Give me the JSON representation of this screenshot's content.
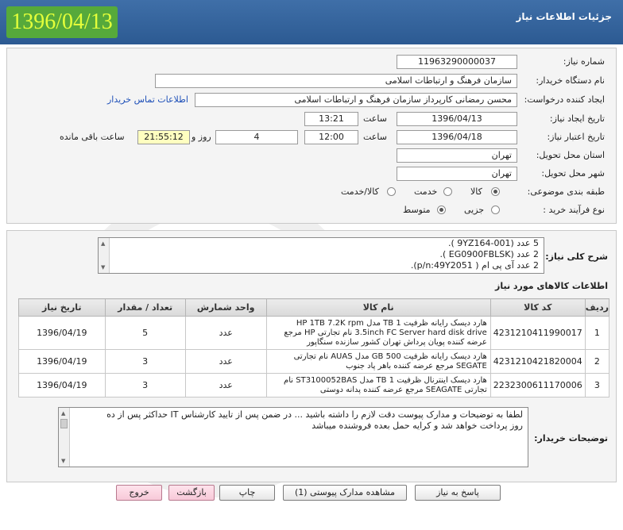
{
  "header": {
    "date": "1396/04/13",
    "title": "جزئیات اطلاعات نیاز"
  },
  "form": {
    "need_number_label": "شماره نیاز:",
    "need_number": "11963290000037",
    "buyer_org_label": "نام دستگاه خریدار:",
    "buyer_org": "سازمان فرهنگ و ارتباطات اسلامی",
    "requester_label": "ایجاد کننده درخواست:",
    "requester": "محسن رمضانی  کارپرداز سازمان فرهنگ و ارتباطات اسلامی",
    "contact_link": "اطلاعات تماس خریدار",
    "created_label": "تاریخ ایجاد نیاز:",
    "created_date": "1396/04/13",
    "time_label": "ساعت",
    "created_time": "13:21",
    "validity_label": "تاریخ اعتبار نیاز:",
    "validity_date": "1396/04/18",
    "validity_time": "12:00",
    "days": "4",
    "days_label": "روز و",
    "countdown": "21:55:12",
    "remaining_label": "ساعت باقی مانده",
    "province_label": "استان محل تحویل:",
    "province": "تهران",
    "city_label": "شهر محل تحویل:",
    "city": "تهران",
    "category_label": "طبقه بندی موضوعی:",
    "category_options": [
      "کالا",
      "خدمت",
      "کالا/خدمت"
    ],
    "category_selected": "کالا",
    "process_label": "نوع فرآیند خرید :",
    "process_options": [
      "جزیی",
      "متوسط"
    ],
    "process_selected": "متوسط"
  },
  "summary": {
    "label": "شرح کلی نیاز:",
    "lines": [
      "5 عدد  (9YZ164-001 ).",
      "2 عدد  (EG0900FBLSK ).",
      "2 عدد آی پی ام  (  p/n:49Y2051)."
    ]
  },
  "items_section_title": "اطلاعات کالاهای مورد نیاز",
  "table": {
    "headers": [
      "ردیف",
      "کد کالا",
      "نام کالا",
      "واحد شمارش",
      "تعداد / مقدار",
      "تاریخ نیاز"
    ],
    "rows": [
      {
        "idx": "1",
        "code": "4231210411990017",
        "name": "هارد دیسک رایانه ظرفیت 1 TB مدل HP 1TB 7.2K rpm 3.5inch FC Server hard disk drive نام تجارتی HP مرجع عرضه کننده پویان پرداش تهران کشور سازنده سنگاپور",
        "unit": "عدد",
        "qty": "5",
        "date": "1396/04/19"
      },
      {
        "idx": "2",
        "code": "4231210421820004",
        "name": "هارد دیسک رایانه ظرفیت 500 GB مدل AUAS نام تجارتی SEGATE مرجع عرضه کننده باهر پاد جنوب",
        "unit": "عدد",
        "qty": "3",
        "date": "1396/04/19"
      },
      {
        "idx": "3",
        "code": "2232300611170006",
        "name": "هارد دیسک اینترنال ظرفیت 1 TB مدل ST3100052BAS نام تجارتی SEAGATE مرجع عرضه کننده پدانه دوستی",
        "unit": "عدد",
        "qty": "3",
        "date": "1396/04/19"
      }
    ]
  },
  "buyer_notes": {
    "label": "توضیحات خریدار:",
    "lines": [
      "لطفا به توضیحات و مدارک پیوست دقت لازم را داشته باشید ... در ضمن پس از تایید کارشناس IT حداکثر پس از ده",
      "روز پرداخت خواهد شد و کرایه حمل بعده فروشنده میباشد"
    ]
  },
  "buttons": {
    "reply": "پاسخ به نیاز",
    "attachments": "مشاهده مدارک پیوستی (1)",
    "print": "چاپ",
    "back": "بازگشت",
    "exit": "خروج"
  }
}
